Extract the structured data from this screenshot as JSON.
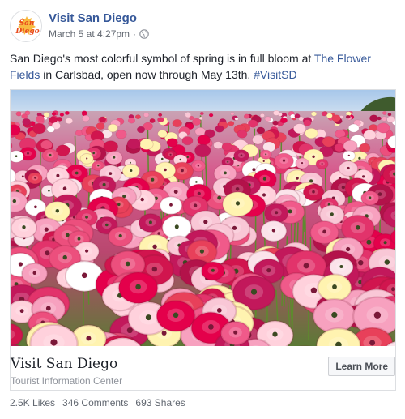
{
  "post": {
    "page_name": "Visit San Diego",
    "timestamp": "March 5 at 4:27pm",
    "separator": "·",
    "privacy_icon": "globe-icon",
    "avatar_logo_text": "San Diego",
    "caption": {
      "text_before": "San Diego's most colorful symbol of spring is in full bloom at ",
      "link_text": "The Flower Fields",
      "text_middle": " in Carlsbad, open now through May 13th. ",
      "hashtag": "#VisitSD"
    },
    "photo": {
      "description_icon": "flower-field-photo"
    },
    "link_card": {
      "title": "Visit San Diego",
      "subtitle": "Tourist Information Center",
      "cta_label": "Learn More"
    },
    "stats": {
      "likes": "2.5K Likes",
      "comments": "346 Comments",
      "shares": "693 Shares"
    }
  },
  "colors": {
    "link_blue": "#365899",
    "meta_gray": "#616770",
    "border": "#dddfe2"
  }
}
